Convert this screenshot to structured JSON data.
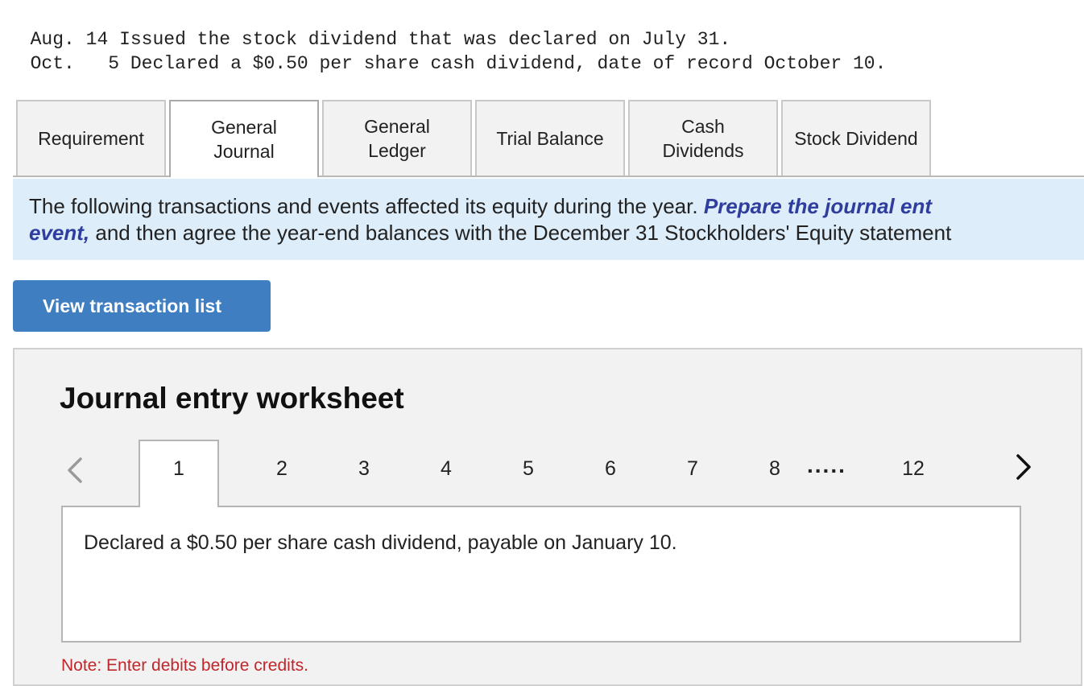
{
  "transactions": [
    {
      "month": "Aug.",
      "day": "14",
      "text": "Issued the stock dividend that was declared on July 31."
    },
    {
      "month": "Oct.",
      "day": " 5",
      "text": "Declared a $0.50 per share cash dividend, date of record October 10."
    }
  ],
  "tabs": [
    {
      "label": "Requirement",
      "active": false
    },
    {
      "label": "General\nJournal",
      "active": true
    },
    {
      "label": "General\nLedger",
      "active": false
    },
    {
      "label": "Trial Balance",
      "active": false
    },
    {
      "label": "Cash\nDividends",
      "active": false
    },
    {
      "label": "Stock Dividend",
      "active": false
    }
  ],
  "info": {
    "text_before": "The following transactions and events affected its equity during the year. ",
    "emphasis_1": "Prepare the journal ent",
    "emphasis_2": "event,",
    "text_after": " and then agree the year-end balances with the December 31 Stockholders' Equity statement"
  },
  "view_button": {
    "label": "View transaction list"
  },
  "worksheet": {
    "title": "Journal entry worksheet",
    "pager": {
      "prev_icon": "chevron-left-icon",
      "next_icon": "chevron-right-icon",
      "active_page": "1",
      "pages": [
        "2",
        "3",
        "4",
        "5",
        "6",
        "7",
        "8"
      ],
      "ellipsis": ".....",
      "last_page": "12"
    },
    "description": "Declared a $0.50 per share cash dividend, payable on January 10.",
    "note": "Note: Enter debits before credits."
  },
  "colors": {
    "accent_button": "#3f7fc1",
    "info_background": "#ddedf9",
    "emphasis_text": "#2f3e9e",
    "note_text": "#c0262c"
  }
}
